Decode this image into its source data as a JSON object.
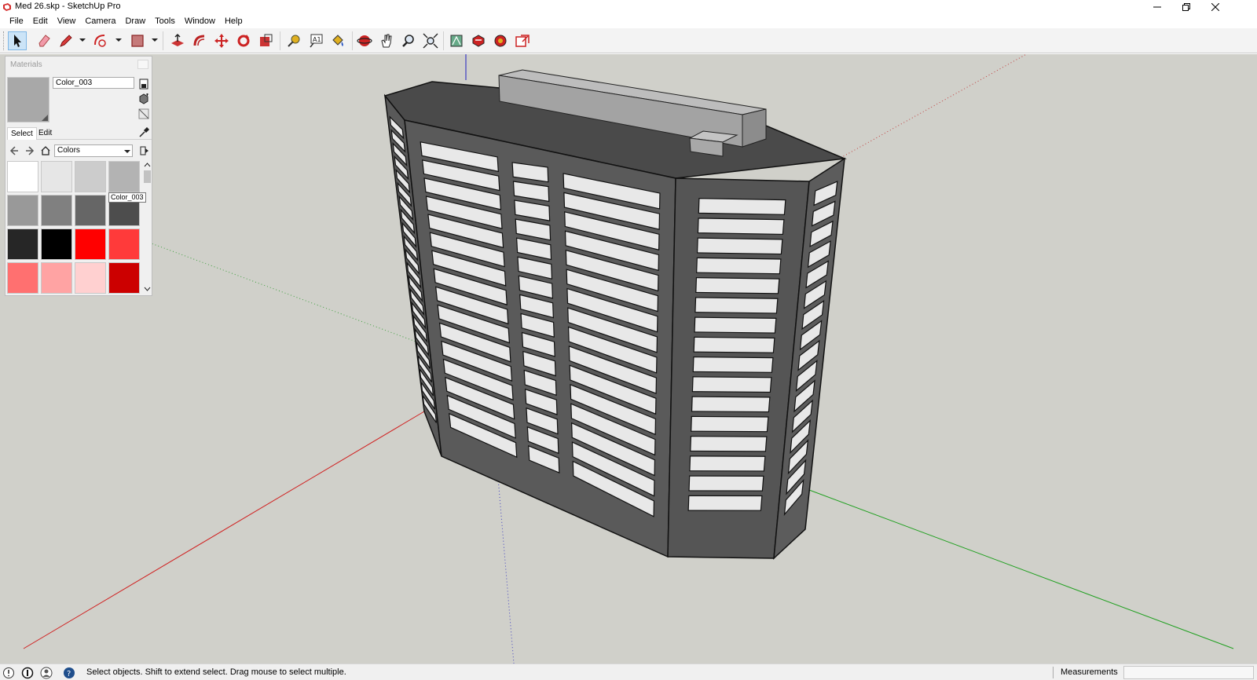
{
  "window": {
    "title": "Med 26.skp - SketchUp Pro"
  },
  "menu": [
    "File",
    "Edit",
    "View",
    "Camera",
    "Draw",
    "Tools",
    "Window",
    "Help"
  ],
  "toolbar": {
    "tools": [
      "select-tool",
      "eraser-tool",
      "line-tool",
      "arc-tool",
      "shape-tool",
      "push-pull-tool",
      "offset-tool",
      "move-tool",
      "rotate-tool",
      "scale-tool",
      "tape-measure-tool",
      "text-tool",
      "paint-bucket-tool",
      "orbit-tool",
      "pan-tool",
      "zoom-tool",
      "zoom-extents-tool",
      "warehouse-tool",
      "extension-warehouse-tool",
      "components-tool",
      "layout-tool"
    ]
  },
  "materials": {
    "title": "Materials",
    "current_name": "Color_003",
    "tabs": {
      "select": "Select",
      "edit": "Edit"
    },
    "collection": "Colors",
    "tooltip": "Color_003",
    "swatches": [
      "#ffffff",
      "#e6e6e6",
      "#cccccc",
      "#b3b3b3",
      "#999999",
      "#808080",
      "#666666",
      "#4d4d4d",
      "#262626",
      "#000000",
      "#ff0000",
      "#ff3a3a",
      "#ff7070",
      "#ffa3a3",
      "#ffd0d0",
      "#cc0000"
    ],
    "current_color": "#a8a8a8"
  },
  "status": {
    "message": "Select objects. Shift to extend select. Drag mouse to select multiple.",
    "measurements_label": "Measurements",
    "measurements_value": ""
  },
  "colors": {
    "viewport_bg": "#d0d0ca",
    "building_dark": "#555555",
    "building_roof": "#4a4a4a",
    "window_fill": "#e8e8e8",
    "axis_red": "#d02020",
    "axis_green": "#20a020",
    "axis_blue": "#2020c0"
  }
}
